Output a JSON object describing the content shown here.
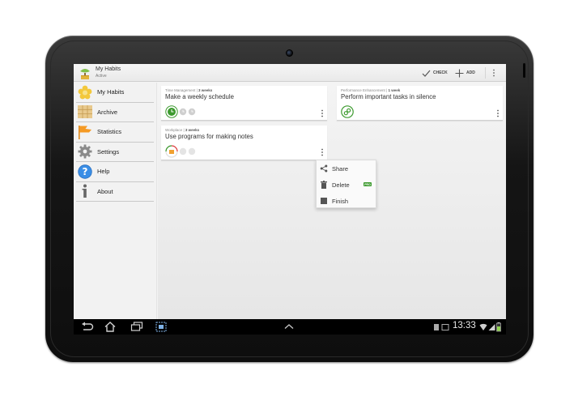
{
  "app": {
    "title": "My Habits",
    "subtitle": "Active"
  },
  "actionbar": {
    "check_label": "CHECK",
    "add_label": "ADD"
  },
  "sidebar": {
    "items": [
      {
        "label": "My Habits",
        "icon": "flower-icon"
      },
      {
        "label": "Archive",
        "icon": "archive-grid-icon"
      },
      {
        "label": "Statistics",
        "icon": "flag-icon"
      },
      {
        "label": "Settings",
        "icon": "gear-icon"
      },
      {
        "label": "Help",
        "icon": "help-icon"
      },
      {
        "label": "About",
        "icon": "info-icon"
      }
    ]
  },
  "habits": [
    {
      "category": "Time Management",
      "duration": "3 weeks",
      "title": "Make a weekly schedule"
    },
    {
      "category": "Performance Enhancement",
      "duration": "1 week",
      "title": "Perform important tasks in silence"
    },
    {
      "category": "Workplace",
      "duration": "3 weeks",
      "title": "Use programs for making notes"
    }
  ],
  "popup_menu": {
    "items": [
      {
        "label": "Share",
        "icon": "share-icon"
      },
      {
        "label": "Delete",
        "icon": "trash-icon",
        "badge": "PRO"
      },
      {
        "label": "Finish",
        "icon": "stop-square-icon"
      }
    ]
  },
  "system_bar": {
    "time": "13:33"
  },
  "colors": {
    "accent_green": "#3c9a2e",
    "progress_orange": "#f0a030",
    "progress_red": "#e04040"
  }
}
